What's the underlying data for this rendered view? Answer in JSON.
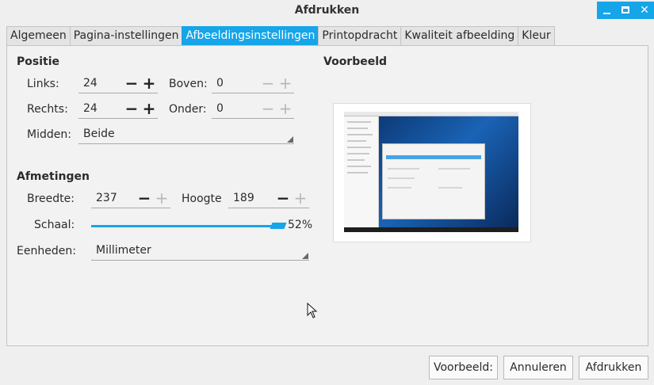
{
  "window": {
    "title": "Afdrukken"
  },
  "tabs": [
    {
      "label": "Algemeen"
    },
    {
      "label": "Pagina-instellingen"
    },
    {
      "label": "Afbeeldingsinstellingen"
    },
    {
      "label": "Printopdracht"
    },
    {
      "label": "Kwaliteit afbeelding"
    },
    {
      "label": "Kleur"
    }
  ],
  "active_tab": "Afbeeldingsinstellingen",
  "position": {
    "title": "Positie",
    "left": {
      "label": "Links:",
      "value": "24"
    },
    "top": {
      "label": "Boven:",
      "value": "0"
    },
    "right": {
      "label": "Rechts:",
      "value": "24"
    },
    "bottom": {
      "label": "Onder:",
      "value": "0"
    },
    "center": {
      "label": "Midden:",
      "value": "Beide"
    }
  },
  "dimensions": {
    "title": "Afmetingen",
    "width": {
      "label": "Breedte:",
      "value": "237"
    },
    "height": {
      "label": "Hoogte",
      "value": "189"
    },
    "scale": {
      "label": "Schaal:",
      "value": "52%",
      "fraction": 0.52
    },
    "units": {
      "label": "Eenheden:",
      "value": "Millimeter"
    }
  },
  "preview": {
    "title": "Voorbeeld"
  },
  "buttons": {
    "preview": "Voorbeeld:",
    "cancel": "Annuleren",
    "print": "Afdrukken"
  },
  "colors": {
    "accent": "#16a5e8",
    "background": "#efefef"
  }
}
